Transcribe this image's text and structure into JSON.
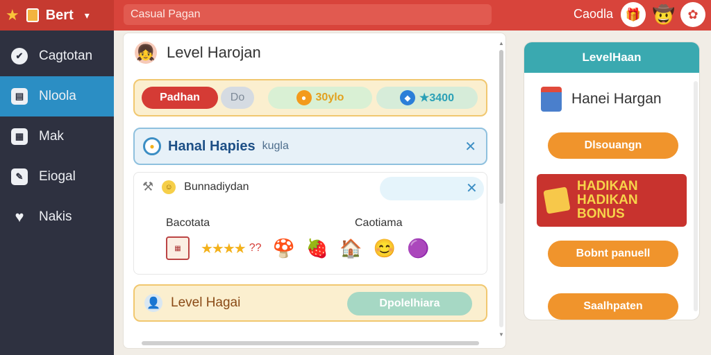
{
  "topbar": {
    "brand": "Bert",
    "search_placeholder": "Casual Pagan",
    "right_label": "Caodla"
  },
  "sidebar": {
    "items": [
      {
        "label": "Cagtotan",
        "icon": "shield-icon"
      },
      {
        "label": "Nloola",
        "icon": "book-icon"
      },
      {
        "label": "Mak",
        "icon": "map-icon"
      },
      {
        "label": "Eiogal",
        "icon": "notes-icon"
      },
      {
        "label": "Nakis",
        "icon": "heart-icon"
      }
    ]
  },
  "main": {
    "title": "Level Harojan",
    "stats": {
      "red_label": "Padhan",
      "grey_label": "Do",
      "coins": "30ylo",
      "gems": "★3400"
    },
    "banner": {
      "title": "Hanal Hapies",
      "sub": "kugla"
    },
    "card": {
      "title": "Bunnadiydan",
      "label_a": "Bacotata",
      "label_b": "Caotiama",
      "stars_tag": "??"
    },
    "level_row": {
      "title": "Level Hagai",
      "button": "Dpolelhiara"
    }
  },
  "right_panel": {
    "header": "LevelHaan",
    "title": "Hanei Hargan",
    "btn1": "Dlsouangn",
    "bonus_line1": "HADIKAN",
    "bonus_line2": "HADIKAN",
    "bonus_line3": "BONUS",
    "btn2": "Bobnt panuell",
    "btn3": "Saalhpaten"
  },
  "colors": {
    "topbar": "#d8443b",
    "sidebar": "#2e3140",
    "sidebar_active": "#2b8ec4",
    "accent_orange": "#f0942c",
    "teal": "#3aa9b0"
  }
}
